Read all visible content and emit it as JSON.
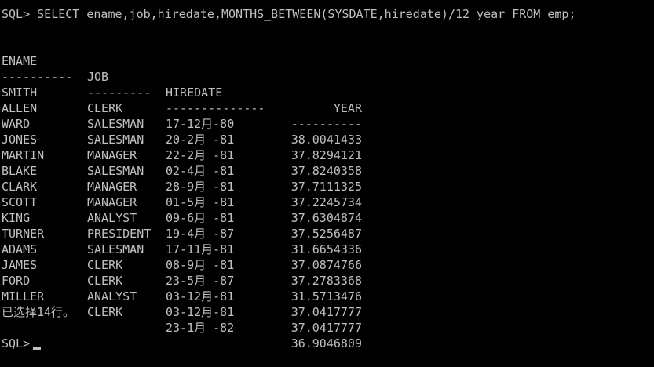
{
  "terminal": {
    "query_line": "SQL> SELECT ename,job,hiredate,MONTHS_BETWEEN(SYSDATE,hiredate)/12 year FROM emp;",
    "headers": {
      "ename": "ENAME",
      "job": "JOB",
      "hiredate": "HIREDATE",
      "year": "YEAR"
    },
    "separators": {
      "ename": "----------",
      "job": "---------",
      "hiredate": "--------------",
      "year": "----------"
    },
    "rows": [
      {
        "ename": "SMITH",
        "job": "CLERK",
        "hiredate": "17-12月-80",
        "year": "38.0041433"
      },
      {
        "ename": "ALLEN",
        "job": "SALESMAN",
        "hiredate": "20-2月 -81",
        "year": "37.8294121"
      },
      {
        "ename": "WARD",
        "job": "SALESMAN",
        "hiredate": "22-2月 -81",
        "year": "37.8240358"
      },
      {
        "ename": "JONES",
        "job": "MANAGER",
        "hiredate": "02-4月 -81",
        "year": "37.7111325"
      },
      {
        "ename": "MARTIN",
        "job": "SALESMAN",
        "hiredate": "28-9月 -81",
        "year": "37.2245734"
      },
      {
        "ename": "BLAKE",
        "job": "MANAGER",
        "hiredate": "01-5月 -81",
        "year": "37.6304874"
      },
      {
        "ename": "CLARK",
        "job": "MANAGER",
        "hiredate": "09-6月 -81",
        "year": "37.5256487"
      },
      {
        "ename": "SCOTT",
        "job": "ANALYST",
        "hiredate": "19-4月 -87",
        "year": "31.6654336"
      },
      {
        "ename": "KING",
        "job": "PRESIDENT",
        "hiredate": "17-11月-81",
        "year": "37.0874766"
      },
      {
        "ename": "TURNER",
        "job": "SALESMAN",
        "hiredate": "08-9月 -81",
        "year": "37.2783368"
      },
      {
        "ename": "ADAMS",
        "job": "CLERK",
        "hiredate": "23-5月 -87",
        "year": "31.5713476"
      },
      {
        "ename": "JAMES",
        "job": "CLERK",
        "hiredate": "03-12月-81",
        "year": "37.0417777"
      },
      {
        "ename": "FORD",
        "job": "ANALYST",
        "hiredate": "03-12月-81",
        "year": "37.0417777"
      },
      {
        "ename": "MILLER",
        "job": "CLERK",
        "hiredate": "23-1月 -82",
        "year": "36.9046809"
      }
    ],
    "row_count_message": "已选择14行。",
    "prompt": "SQL>"
  },
  "colors": {
    "background": "#000000",
    "text": "#c0c0c0"
  }
}
